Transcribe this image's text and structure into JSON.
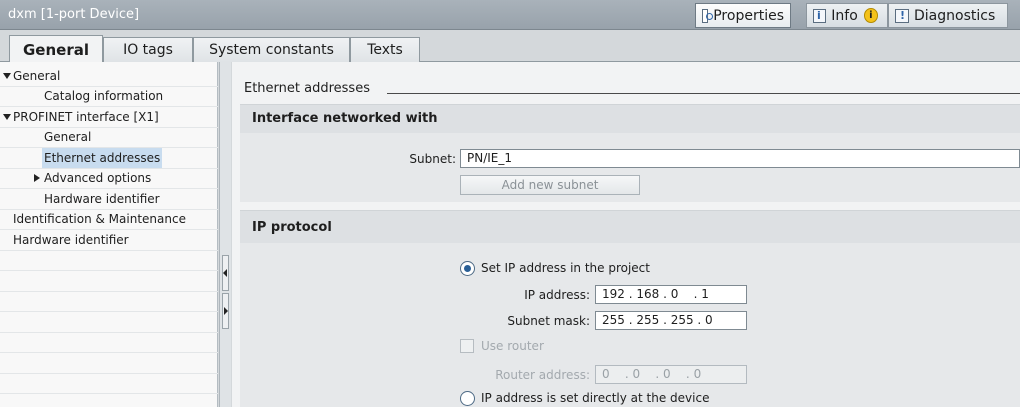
{
  "window": {
    "title": "dxm [1-port Device]"
  },
  "top_tabs": [
    {
      "label": "Properties",
      "icon": "properties-icon",
      "active": true
    },
    {
      "label": "Info",
      "icon": "info-icon",
      "badge": "i"
    },
    {
      "label": "Diagnostics",
      "icon": "diagnostics-icon"
    }
  ],
  "tabs": [
    "General",
    "IO tags",
    "System constants",
    "Texts"
  ],
  "tree": {
    "items": [
      {
        "label": "General",
        "expanded": true
      },
      {
        "label": "Catalog information"
      },
      {
        "label": "PROFINET interface [X1]",
        "expanded": true
      },
      {
        "label": "General"
      },
      {
        "label": "Ethernet addresses",
        "selected": true
      },
      {
        "label": "Advanced options",
        "collapsed": true
      },
      {
        "label": "Hardware identifier"
      },
      {
        "label": "Identification & Maintenance"
      },
      {
        "label": "Hardware identifier"
      }
    ]
  },
  "main": {
    "section_title": "Ethernet addresses",
    "interface_group": {
      "heading": "Interface networked with",
      "subnet_label": "Subnet:",
      "subnet_value": "PN/IE_1",
      "add_subnet_button": "Add new subnet"
    },
    "ip_group": {
      "heading": "IP protocol",
      "set_ip_option": "Set IP address in the project",
      "ip_address_label": "IP address:",
      "ip_address_value": "192 . 168 . 0    . 1",
      "subnet_mask_label": "Subnet mask:",
      "subnet_mask_value": "255 . 255 . 255 . 0",
      "use_router_label": "Use router",
      "router_address_label": "Router address:",
      "router_address_value": "0    . 0    . 0    . 0",
      "direct_ip_option": "IP address is set directly at the device"
    }
  },
  "colors": {
    "accent": "#2a5f96",
    "selection": "#c8dcef",
    "titlebar": "#a9b2ba",
    "warning_badge": "#f4c21a"
  }
}
